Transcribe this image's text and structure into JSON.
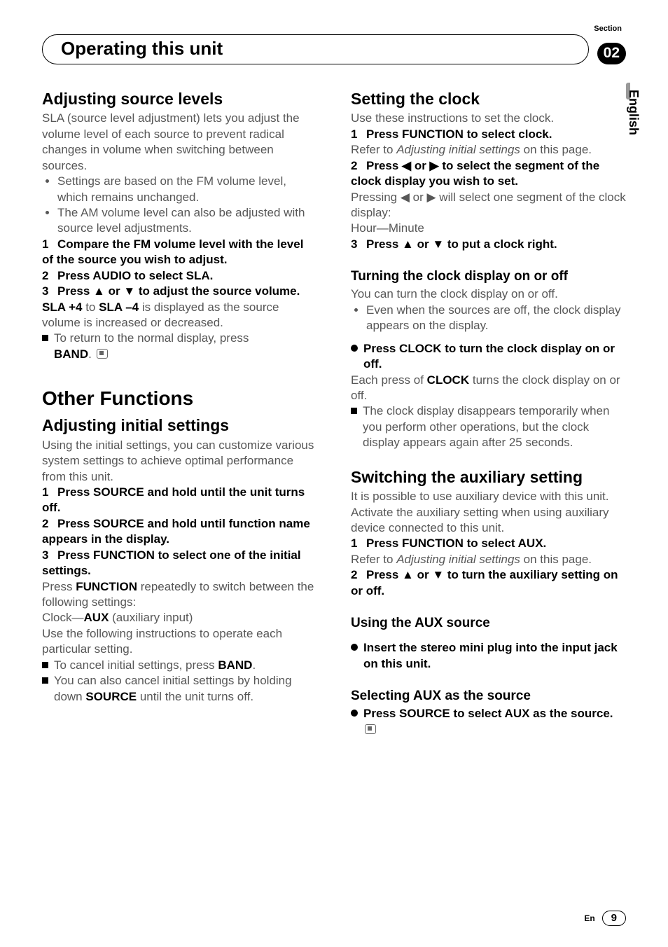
{
  "header": {
    "section_label": "Section",
    "title": "Operating this unit",
    "section_number": "02"
  },
  "side_tab": {
    "language": "English"
  },
  "left": {
    "h_adjusting_source_levels": "Adjusting source levels",
    "p_sla_intro": "SLA (source level adjustment) lets you adjust the volume level of each source to prevent radical changes in volume when switching between sources.",
    "bul_fm": "Settings are based on the FM volume level, which remains unchanged.",
    "bul_am": "The AM volume level can also be adjusted with source level adjustments.",
    "step1": "Compare the FM volume level with the level of the source you wish to adjust.",
    "step2": "Press AUDIO to select SLA.",
    "step3": "Press ▲ or ▼ to adjust the source volume.",
    "p_sla_range_a": "SLA +4",
    "p_sla_range_mid": " to ",
    "p_sla_range_b": "SLA –4",
    "p_sla_range_tail": " is displayed as the source volume is increased or decreased.",
    "note_return": "To return to the normal display, press ",
    "note_return_band": "BAND",
    "note_return_period": ".",
    "h_other_functions": "Other Functions",
    "h_adjusting_initial": "Adjusting initial settings",
    "p_initial_intro": "Using the initial settings, you can customize various system settings to achieve optimal performance from this unit.",
    "i_step1": "Press SOURCE and hold until the unit turns off.",
    "i_step2": "Press SOURCE and hold until function name appears in the display.",
    "i_step3": "Press FUNCTION to select one of the initial settings.",
    "p_press_function_pre": "Press ",
    "p_press_function_bold": "FUNCTION",
    "p_press_function_post": " repeatedly to switch between the following settings:",
    "p_clock_aux_pre": "Clock—",
    "p_clock_aux_bold": "AUX",
    "p_clock_aux_post": " (auxiliary input)",
    "p_use_following": "Use the following instructions to operate each particular setting.",
    "note_cancel_pre": "To cancel initial settings, press ",
    "note_cancel_band": "BAND",
    "note_cancel_period": ".",
    "note_cancel2_pre": "You can also cancel initial settings by holding down ",
    "note_cancel2_source": "SOURCE",
    "note_cancel2_post": " until the unit turns off."
  },
  "right": {
    "h_setting_clock": "Setting the clock",
    "p_setting_clock_intro": "Use these instructions to set the clock.",
    "c_step1": "Press FUNCTION to select clock.",
    "c_step1_refer_pre": "Refer to ",
    "c_step1_refer_ital": "Adjusting initial settings",
    "c_step1_refer_post": " on this page.",
    "c_step2": "Press ◀ or ▶ to select the segment of the clock display you wish to set.",
    "c_step2_body_pre": "Pressing ◀ or ▶ will select one segment of the clock display:",
    "c_step2_body_hm": "Hour—Minute",
    "c_step3": "Press ▲ or ▼ to put a clock right.",
    "h_turning_clock": "Turning the clock display on or off",
    "p_turning_intro": "You can turn the clock display on or off.",
    "bul_even": "Even when the sources are off, the clock display appears on the display.",
    "press_clock": "Press CLOCK to turn the clock display on or off.",
    "p_each_press_pre": "Each press of ",
    "p_each_press_bold": "CLOCK",
    "p_each_press_post": " turns the clock display on or off.",
    "note_disappears": "The clock display disappears temporarily when you perform other operations, but the clock display appears again after 25 seconds.",
    "h_switching_aux": "Switching the auxiliary setting",
    "p_aux_intro": "It is possible to use auxiliary device with this unit. Activate the auxiliary setting when using auxiliary device connected to this unit.",
    "a_step1": "Press FUNCTION to select AUX.",
    "a_step1_refer_pre": "Refer to ",
    "a_step1_refer_ital": "Adjusting initial settings",
    "a_step1_refer_post": " on this page.",
    "a_step2": "Press ▲ or ▼ to turn the auxiliary setting on or off.",
    "h_using_aux": "Using the AUX source",
    "using_aux_action": "Insert the stereo mini plug into the input jack on this unit.",
    "h_selecting_aux": "Selecting AUX as the source",
    "selecting_aux_action": "Press SOURCE to select AUX as the source."
  },
  "footer": {
    "lang_short": "En",
    "page_number": "9"
  }
}
